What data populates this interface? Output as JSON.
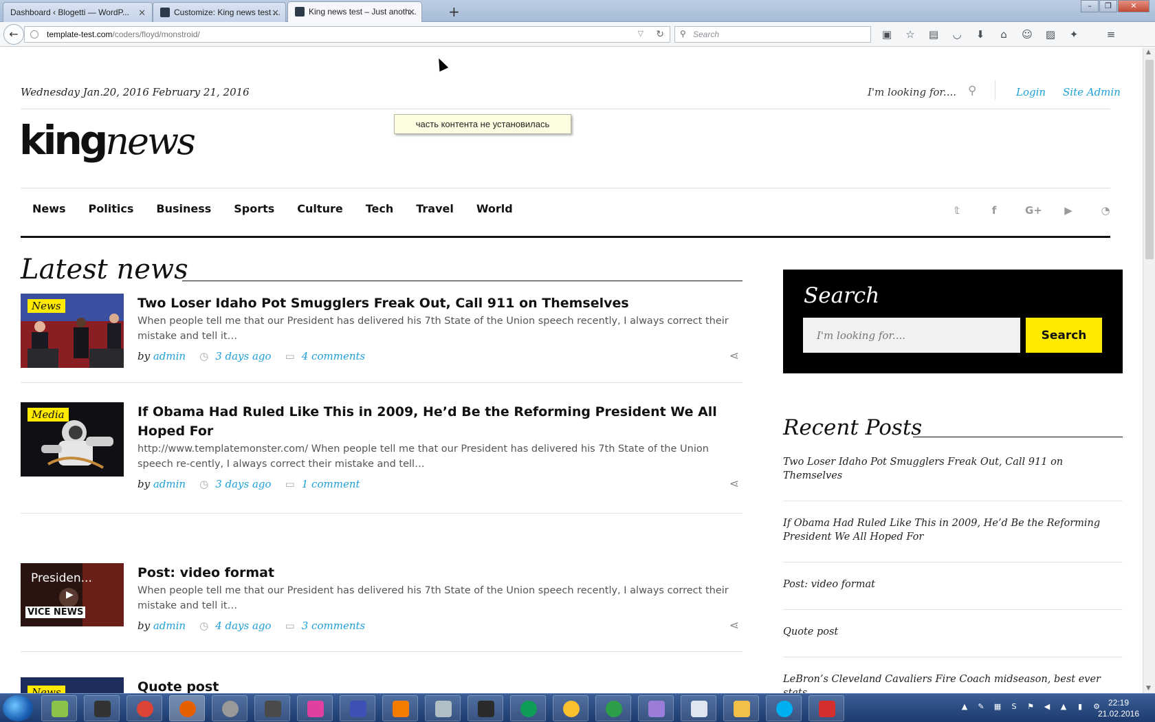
{
  "browser": {
    "tabs": [
      {
        "label": "Dashboard ‹ Blogetti — WordP..."
      },
      {
        "label": "Customize: King news test ..."
      },
      {
        "label": "King news test – Just anoth..."
      }
    ],
    "url_domain": "template-test.com",
    "url_path": "/coders/floyd/monstroid/",
    "search_placeholder": "Search"
  },
  "header": {
    "date_text": "Wednesday Jan.20, 2016 February 21, 2016",
    "search_placeholder": "I'm looking for....",
    "login_label": "Login",
    "site_admin_label": "Site Admin",
    "logo_bold": "king",
    "logo_italic": "news",
    "tooltip": "часть контента не установилась"
  },
  "nav": {
    "items": [
      "News",
      "Politics",
      "Business",
      "Sports",
      "Culture",
      "Tech",
      "Travel",
      "World"
    ],
    "social_icons": [
      "twitter-icon",
      "facebook-icon",
      "google-plus-icon",
      "youtube-icon",
      "rss-icon"
    ]
  },
  "main": {
    "heading": "Latest news",
    "posts": [
      {
        "badge": "News",
        "title": "Two Loser Idaho Pot Smugglers Freak Out, Call 911 on Themselves",
        "excerpt": "When people tell me that our President has delivered his 7th State of the Union speech recently, I always correct their mistake and tell it…",
        "author_prefix": "by",
        "author": "admin",
        "time": "3 days ago",
        "comments": "4 comments"
      },
      {
        "badge": "Media",
        "title": "If Obama Had Ruled Like This in 2009, He’d Be the Reforming President We All Hoped For",
        "excerpt": "http://www.templatemonster.com/ When people tell me that our President has delivered his 7th State of the Union speech re-cently, I always correct their mistake and tell…",
        "author_prefix": "by",
        "author": "admin",
        "time": "3 days ago",
        "comments": "1 comment"
      },
      {
        "badge": "",
        "video_title": "Presiden...",
        "video_brand": "VICE NEWS",
        "title": "Post: video format",
        "excerpt": "When people tell me that our President has delivered his 7th State of the Union speech recently, I always correct their mistake and tell it…",
        "author_prefix": "by",
        "author": "admin",
        "time": "4 days ago",
        "comments": "3 comments"
      },
      {
        "badge": "News",
        "title": "Quote post"
      }
    ]
  },
  "sidebar": {
    "search_title": "Search",
    "search_placeholder": "I'm looking for....",
    "search_button": "Search",
    "recent_title": "Recent Posts",
    "recent_posts": [
      "Two Loser Idaho Pot Smugglers Freak Out, Call 911 on Themselves",
      "If Obama Had Ruled Like This in 2009, He’d Be the Reforming President We All Hoped For",
      "Post: video format",
      "Quote post",
      "LeBron’s Cleveland Cavaliers Fire Coach midseason, best ever stats"
    ]
  },
  "taskbar": {
    "time": "22:19",
    "date": "21.02.2016"
  },
  "colors": {
    "accent_yellow": "#ffea00",
    "link_blue": "#1ea0d8",
    "search_box_bg": "#000000"
  }
}
